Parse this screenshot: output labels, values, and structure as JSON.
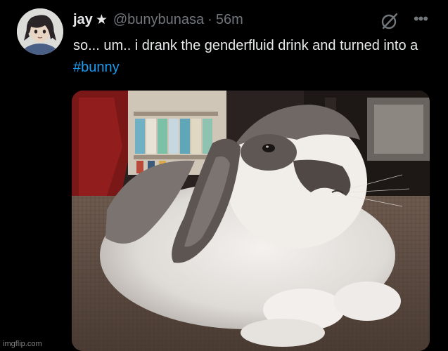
{
  "tweet": {
    "display_name": "jay",
    "badge_icon": "star-icon",
    "handle": "@bunybunasa",
    "separator": "·",
    "time": "56m",
    "text_part1": "so... um.. i drank the genderfluid drink and turned into a ",
    "hashtag": "#bunny",
    "more_icon": "more-options-icon",
    "grok_icon": "grok-icon"
  },
  "media": {
    "subject": "photo-of-lop-eared-rabbit"
  },
  "watermark": "imgflip.com",
  "colors": {
    "background": "#000000",
    "text": "#e7e9ea",
    "secondary": "#71767b",
    "link": "#1d9bf0"
  }
}
